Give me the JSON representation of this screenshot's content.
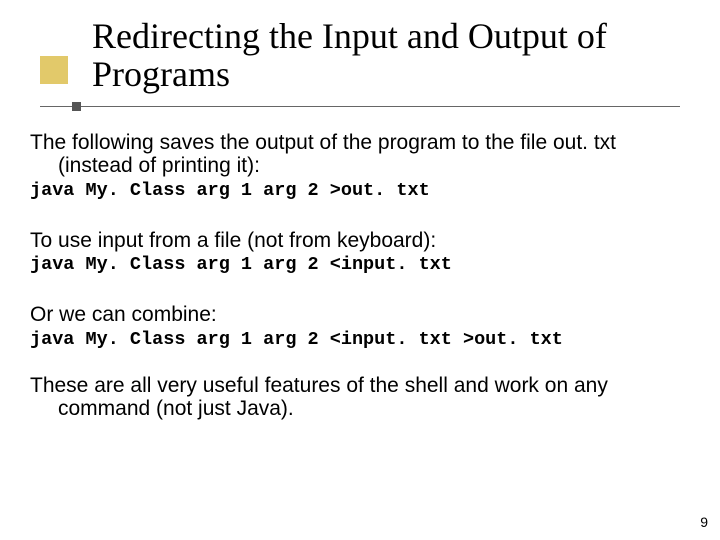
{
  "title": "Redirecting the Input and Output of Programs",
  "para1": "The following saves the output of the program to the file out. txt (instead of printing it):",
  "code1": "java My. Class arg 1 arg 2 >out. txt",
  "para2": "To use input from a file (not from keyboard):",
  "code2": "java My. Class arg 1 arg 2 <input. txt",
  "para3": "Or we can combine:",
  "code3": "java My. Class arg 1 arg 2 <input. txt >out. txt",
  "para4": "These are all very useful features of the shell and work on any command (not just Java).",
  "page_number": "9"
}
